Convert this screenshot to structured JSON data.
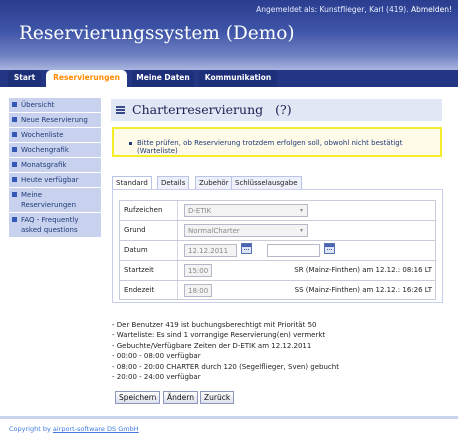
{
  "header": {
    "login_text": "Angemeldet als: Kunstflieger, Karl (419).",
    "logout_link": "Abmelden!",
    "title": "Reservierungssystem (Demo)"
  },
  "tabs": [
    {
      "label": "Start"
    },
    {
      "label": "Reservierungen"
    },
    {
      "label": "Meine Daten"
    },
    {
      "label": "Kommunikation"
    }
  ],
  "sidebar": {
    "items": [
      {
        "label": "Übersicht"
      },
      {
        "label": "Neue Reservierung"
      },
      {
        "label": "Wochenliste"
      },
      {
        "label": "Wochengrafik"
      },
      {
        "label": "Monatsgrafik"
      },
      {
        "label": "Heute verfügbar"
      },
      {
        "label": "Meine Reservierungen"
      },
      {
        "label": "FAQ - Frequently asked questions"
      }
    ]
  },
  "page": {
    "title": "Charterreservierung",
    "help": "(?)"
  },
  "notice": {
    "text": "Bitte prüfen, ob Reservierung trotzdem erfolgen soll, obwohl nicht bestätigt (Warteliste)"
  },
  "form_tabs": [
    {
      "label": "Standard"
    },
    {
      "label": "Details"
    },
    {
      "label": "Zubehör"
    },
    {
      "label": "Schlüsselausgabe"
    }
  ],
  "form": {
    "rufzeichen": {
      "label": "Rufzeichen",
      "value": "D-ETIK"
    },
    "grund": {
      "label": "Grund",
      "value": "NormalCharter"
    },
    "datum": {
      "label": "Datum",
      "value": "12.12.2011",
      "value2": ""
    },
    "startzeit": {
      "label": "Startzeit",
      "value": "15:00",
      "info": "SR (Mainz-Finthen) am 12.12.: 08:16 LT"
    },
    "endezeit": {
      "label": "Endezeit",
      "value": "18:00",
      "info": "SS (Mainz-Finthen) am 12.12.: 16:26 LT"
    }
  },
  "info_lines": [
    "- Der Benutzer 419 ist buchungsberechtigt mit Priorität 50",
    "- Warteliste: Es sind 1 vorrangige Reservierung(en) vermerkt",
    "- Gebuchte/Verfügbare Zeiten der D-ETIK am 12.12.2011",
    "- 00:00 - 08:00 verfügbar",
    "- 08:00 - 20:00 CHARTER durch 120 (Segelflieger, Sven) gebucht",
    "- 20:00 - 24:00 verfügbar"
  ],
  "buttons": {
    "save": "Speichern",
    "change": "Ändern",
    "back": "Zurück"
  },
  "footer": {
    "text": "Copyright by",
    "link": "airport-software DS GmbH"
  }
}
